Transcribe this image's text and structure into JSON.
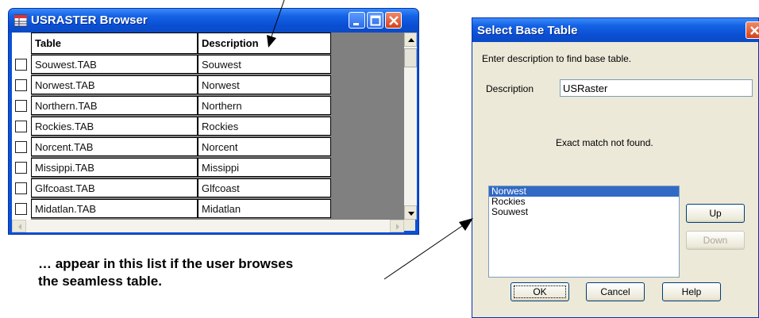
{
  "browser": {
    "title": "USRASTER Browser",
    "columns": [
      "Table",
      "Description"
    ],
    "rows": [
      {
        "table": "Souwest.TAB",
        "description": "Souwest"
      },
      {
        "table": "Norwest.TAB",
        "description": "Norwest"
      },
      {
        "table": "Northern.TAB",
        "description": "Northern"
      },
      {
        "table": "Rockies.TAB",
        "description": "Rockies"
      },
      {
        "table": "Norcent.TAB",
        "description": "Norcent"
      },
      {
        "table": "Missippi.TAB",
        "description": "Missippi"
      },
      {
        "table": "Glfcoast.TAB",
        "description": "Glfcoast"
      },
      {
        "table": "Midatlan.TAB",
        "description": "Midatlan"
      }
    ]
  },
  "dialog": {
    "title": "Select Base Table",
    "instruction": "Enter description to find base table.",
    "description_label": "Description",
    "description_value": "USRaster",
    "status": "Exact match not found.",
    "list_items": [
      "Norwest",
      "Rockies",
      "Souwest"
    ],
    "selected_item": "Norwest",
    "buttons": {
      "up": "Up",
      "down": "Down",
      "ok": "OK",
      "cancel": "Cancel",
      "help": "Help"
    }
  },
  "annotation": {
    "line1": "… appear in this list if the user browses",
    "line2": "the seamless table."
  },
  "colors": {
    "titlebar_blue": "#0a52d6",
    "selection_blue": "#316ac5",
    "close_red": "#d2421b",
    "dialog_bg": "#ece9d8"
  }
}
